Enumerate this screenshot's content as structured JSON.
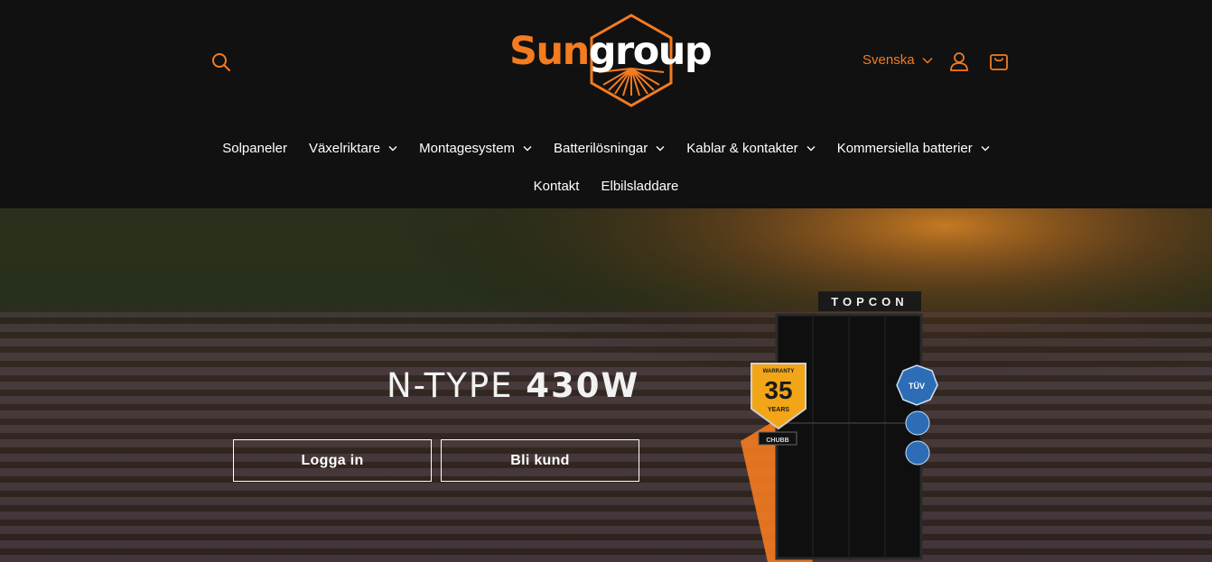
{
  "brand": {
    "logo_part1": "Sun",
    "logo_part2": "group",
    "orange": "#f47b20",
    "header_bg": "#111111"
  },
  "header": {
    "search_icon": "search-icon",
    "language_label": "Svenska",
    "account_icon": "user-icon",
    "cart_icon": "bag-icon"
  },
  "nav": {
    "row1": [
      {
        "label": "Solpaneler",
        "dropdown": false
      },
      {
        "label": "Växelriktare",
        "dropdown": true
      },
      {
        "label": "Montagesystem",
        "dropdown": true
      },
      {
        "label": "Batterilösningar",
        "dropdown": true
      },
      {
        "label": "Kablar & kontakter",
        "dropdown": true
      },
      {
        "label": "Kommersiella batterier",
        "dropdown": true
      }
    ],
    "row2": [
      {
        "label": "Kontakt",
        "dropdown": false
      },
      {
        "label": "Elbilsladdare",
        "dropdown": false
      }
    ]
  },
  "hero": {
    "title_thin": "N-TYPE ",
    "title_bold": "430W",
    "login_button": "Logga in",
    "signup_button": "Bli kund",
    "panel_badge": "TOPCON",
    "warranty_top": "WARRANTY",
    "warranty_number": "35",
    "warranty_bottom": "YEARS",
    "insurer": "CHUBB",
    "cert": "TÜV"
  }
}
